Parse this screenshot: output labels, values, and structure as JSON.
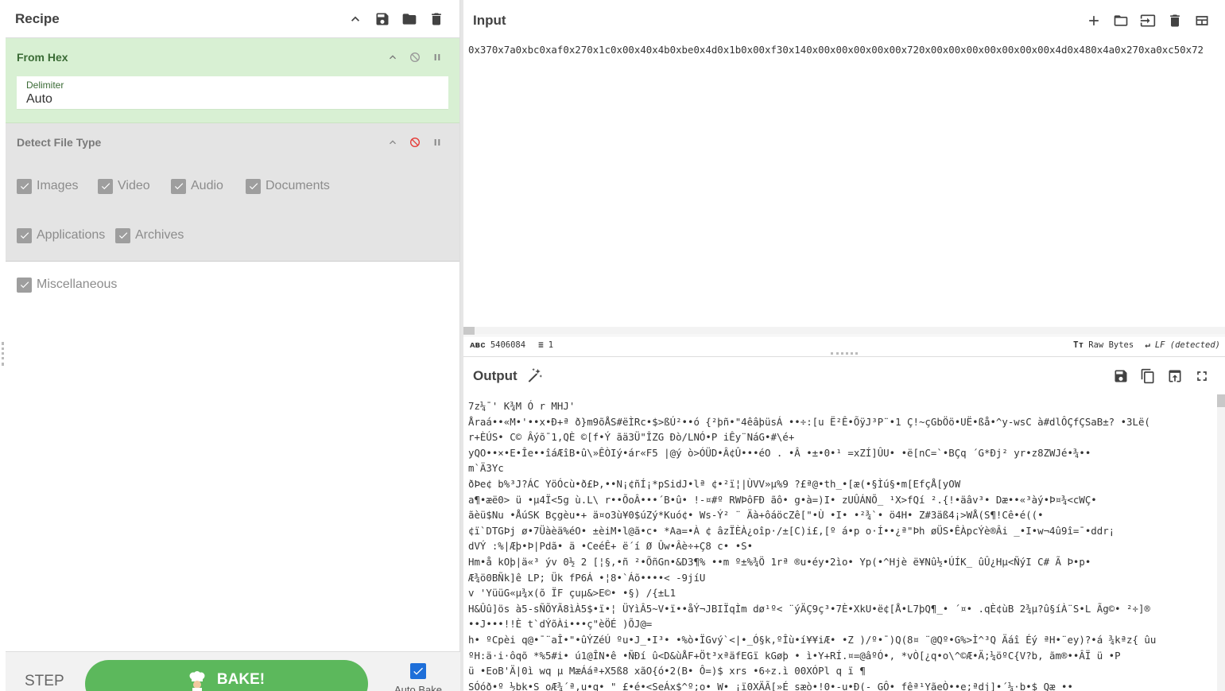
{
  "recipe": {
    "title": "Recipe",
    "operations": [
      {
        "name": "From Hex",
        "delimiter_label": "Delimiter",
        "delimiter_value": "Auto"
      },
      {
        "name": "Detect File Type",
        "checkboxes": [
          "Images",
          "Video",
          "Audio",
          "Documents",
          "Applications",
          "Archives",
          "Miscellaneous"
        ]
      }
    ],
    "step_label": "STEP",
    "bake_label": "BAKE!",
    "auto_bake_label": "Auto Bake"
  },
  "input": {
    "title": "Input",
    "text": "0x370x7a0xbc0xaf0x270x1c0x00x40x4b0xbe0x4d0x1b0x00xf30x140x00x00x00x00x00x720x00x00x00x00x00x00x00x4d0x480x4a0x270xa0xc50x72",
    "length": "5406084",
    "lines": "1",
    "format": "Raw Bytes",
    "eol": "LF (detected)"
  },
  "output": {
    "title": "Output",
    "lines": [
      "7z¼¯'  K¾M Ó  r  MHJ'",
      "Åraá••«M•'••x•Ð+ª  ð}m9õÅS#ëÌRc•$>ßÚ²••ó {²þñ•\"4êâþüsÁ ••÷:[u Ë²Ê•ÕÿJ³P¨•1 Ç!~çGbÖö•UË•ßå•^y-wsC  à#dlÔÇfÇSaB±? •3Lë(",
      "r+ÈÚS• C© Âýõ¯1,QÈ  ©[f•Ý ãä3Ü\"ÎZG Ðò/LNÓ•P iÊy¨NáG•#\\é+",
      "yQO••×•E•Îe••îáÆîB•û\\»ÊÒIý•ár«F5 |@ý ò>ÓÜD•Â¢Û•••éO . •Â  •±•0•¹  =xZÍ]ÛU• •ë[nC=`•BÇq ´G*Ðj² yr•z8ZWJé•¾••",
      "m`Ä3Yc",
      " ðÞe¢ b%³J?ÁC  YöÓcù•ð£Þ,••N¡¢ñÍ¡*pSidJ•lª ¢•²ï¦|ÙVV»µ%9 ?£ª@•th_•[æ(•§Ìú§•m[EfçÅ[yOW",
      "a¶•æë0> ü •µ4Ï<5g ù.L\\  r••ÕoÂ•••´B•û•  !-¤#º RWÞôFÐ ãô•  g•à=)I•  zUÛÁNÕ_ ¹X>fQí ².{!•äâv³• Dæ••«³àý•Þ¤¾<cWÇ•",
      "ãèü$Nu •ÅúSK  Bçgèu•+  ä¤o3ù¥0$úZý*Kuó¢• Ws-Ý²  ¨  Äà+ôáöcZê[\"•Ù  •I•  •²¾`• ö4H•     Z#3äß4¡>WÅ(S¶!Cê•é((•",
      "¢ï`DTGÞj ø•7Üàèä%éO• ±èiM•l@ã•c•  *Aa=•À ¢  âzÏÈÀ¿oîp·/±[C)i£,[º  á•p  o·Í••¿ª\"Þh øÜS•ÊÀpcÝè®Âi   _•I•w¬4û9î=¯•ddr¡",
      "dVÝ :%|Æþ•Þ|Pdã• ä •CeéÊ+  ë´í Ø Ûw•Âè÷+Ç8 c•  •S•",
      "Hm•å kOþ|ä«³ ýv 0½  2 [¦§,•ñ  ²•ÕñGn•&D3¶% ••m º±%¾Ö 1rª  ®u•éy•2ìo•  Yp(•^Hjè ë¥Nû½•ÚÍK_   ûÛ¿Hµ<ÑýI  C#  Ã Þ•p•",
      "Æ¾ö0BÑk]ê LP;     Ük fP6Á  •¦8•`Áõ••••<  -9jíU",
      "v 'YüüG«µ¾x(õ ÏF çuµ&>E©•  •§)  /{±L1",
      "H&Ûû]ös à5-sÑÕYÃ8ìÀ5$•ï•¦  ÜYìÂ5~V•ï••åÝ¬JBIÏqÌm dø¹º<  ¨ýÄÇ9ç³•7È•XkU•ë¢[Å•L7þQ¶_• ´¤• .qÈ¢ùB 2¾µ?û§íÀ¨S•L Ãg©•  ²÷]®",
      "••J•••!!È t`dÝõÀi•••ç\"èÖÉ )ÕJ@=",
      "h• ºCpèi q@•¯¨aÎ•\"•ûÝZéÚ ºu•J_•I³• •%ò•ÏGvý`<|•_Ó§k,ºÎù•í¥¥iÆ•  •Z )/º•¯)Q(8¤ ¨@Qº•G%>Ì^³Q Äáî Éý ªH•¨ey)?•á ¾kªz{ ûu",
      "ºH:ä·i·ôqõ *%5#i• ú1@ÎN•ê •ÑÐí û<D&ùÅF+Öt³xªäfEGï kGøþ • ì•Y+RÍ.¤=@âºÓ•, *vÒ[¿q•o\\^©Æ•Ä;¼öºC{V?b, ãm®••ÂÏ  ü •P",
      "ü •EoB'Ä|0ì wq µ MæÁáª+X5ß8 xãO{ó•2(B•  Ô=)$ xrs •6÷z.ì 00XÓPl q ï ¶",
      "SÓóð•º ½bk•S oÆ¾´ª,u•q•  \"  £•é•<SeÁx$^º;o• W•  ¡ï0XÄÃ[»É sæò•!0•-u•Ð(-  GÔ• fêª¹YãeÒ••e;ªdj]•´¼·b•$  Qæ_••"
    ]
  }
}
